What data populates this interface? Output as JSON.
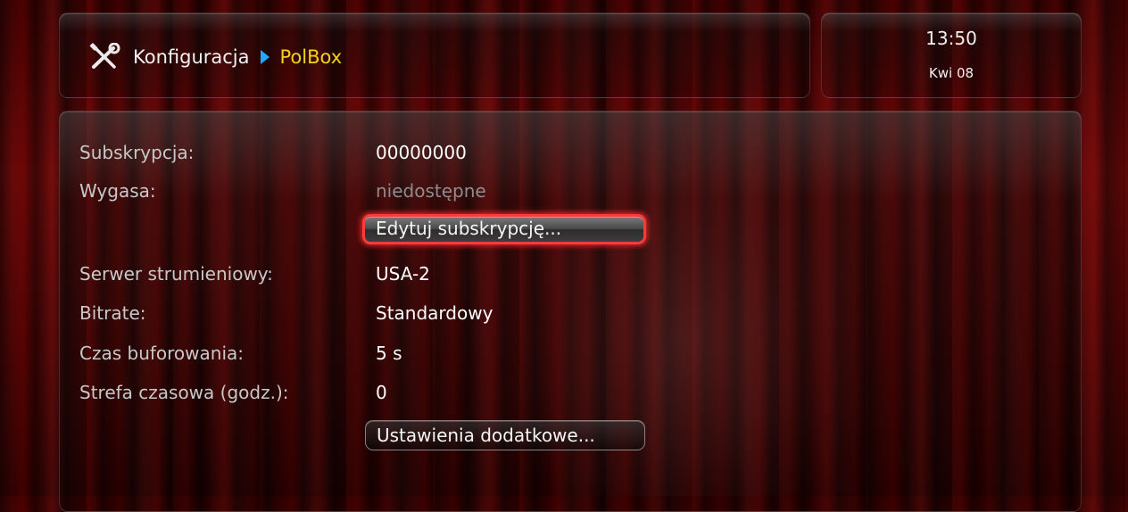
{
  "header": {
    "root": "Konfiguracja",
    "current": "PolBox"
  },
  "clock": {
    "time": "13:50",
    "date": "Kwi 08"
  },
  "settings": [
    {
      "label": "Subskrypcja:",
      "value": "00000000"
    },
    {
      "label": "Wygasa:",
      "value": "niedostępne"
    },
    {
      "label": "Serwer strumieniowy:",
      "value": "USA-2"
    },
    {
      "label": "Bitrate:",
      "value": "Standardowy"
    },
    {
      "label": "Czas buforowania:",
      "value": "5 s"
    },
    {
      "label": "Strefa czasowa (godz.):",
      "value": "0"
    }
  ],
  "buttons": {
    "edit_subscription": "Edytuj subskrypcję...",
    "additional_settings": "Ustawienia dodatkowe..."
  },
  "icons": {
    "header_icon": "tools-icon",
    "breadcrumb_separator": "triangle-right-icon"
  },
  "colors": {
    "breadcrumb_current": "#f4d21b",
    "breadcrumb_arrow": "#1ea7ff",
    "focus_ring": "#ff3a3a",
    "dim_value": "#8c8c8c"
  }
}
